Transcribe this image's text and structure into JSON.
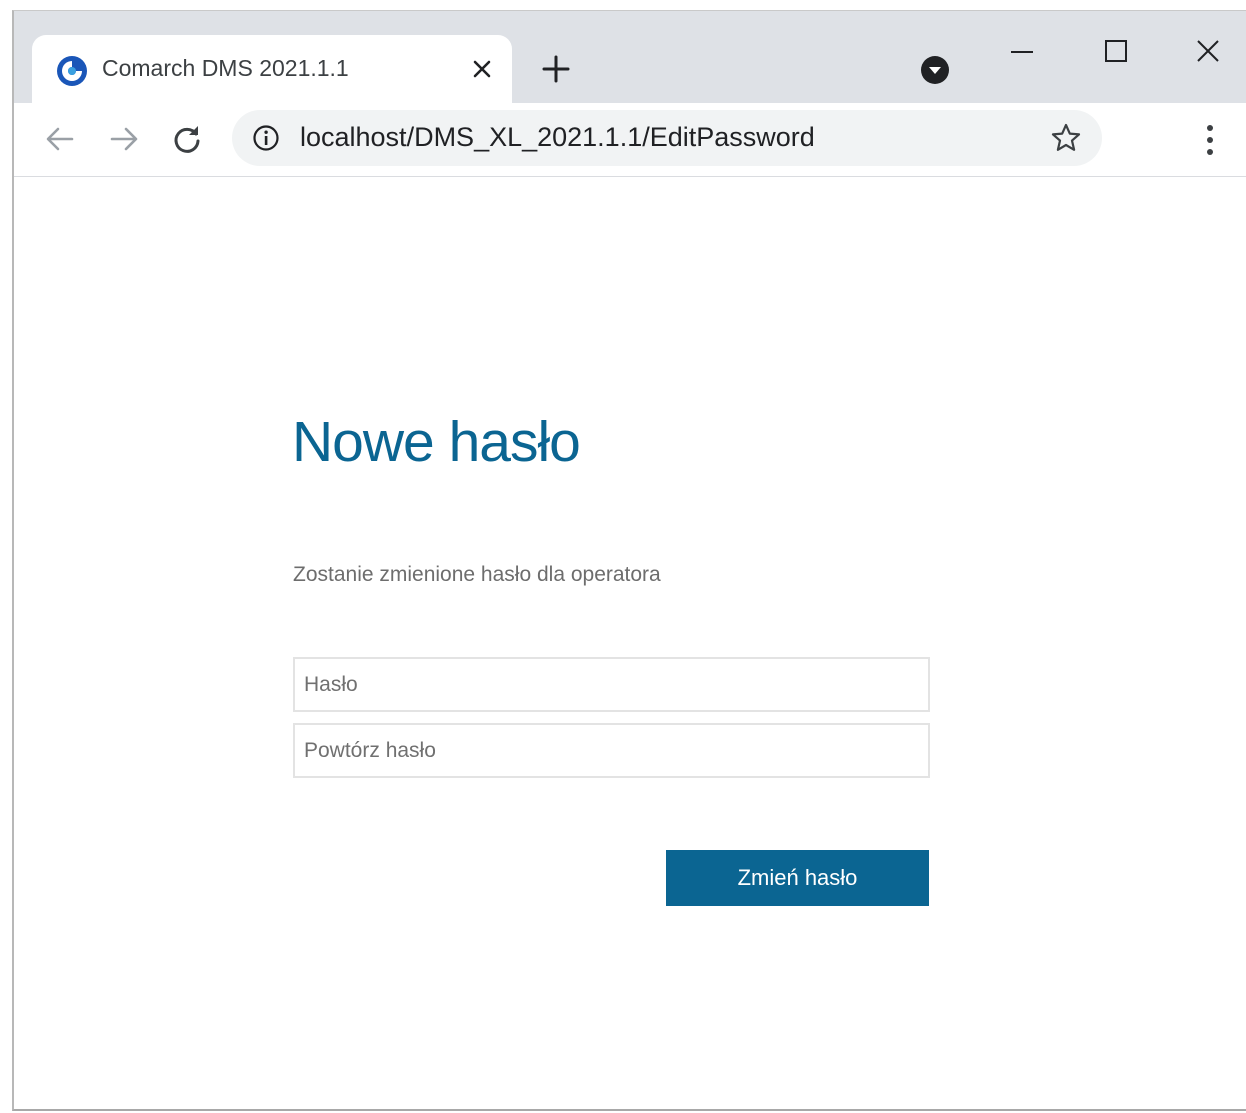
{
  "browser": {
    "tab": {
      "favicon": "comarch-logo-icon",
      "title": "Comarch DMS 2021.1.1",
      "close_icon": "close-icon"
    },
    "new_tab_icon": "plus-icon",
    "profile_icon": "profile-dropdown-icon",
    "window_controls": [
      "minimize-icon",
      "maximize-icon",
      "close-icon"
    ],
    "toolbar": {
      "back_icon": "arrow-left-icon",
      "forward_icon": "arrow-right-icon",
      "reload_icon": "reload-icon",
      "site_info_icon": "info-icon",
      "url": "localhost/DMS_XL_2021.1.1/EditPassword",
      "bookmark_icon": "star-icon",
      "menu_icon": "kebab-menu-icon"
    }
  },
  "page": {
    "title": "Nowe hasło",
    "subtitle": "Zostanie zmienione hasło dla operatora",
    "password_field": {
      "placeholder": "Hasło",
      "value": ""
    },
    "repeat_field": {
      "placeholder": "Powtórz hasło",
      "value": ""
    },
    "submit_label": "Zmień hasło"
  },
  "colors": {
    "accent": "#0b6592",
    "tabstrip": "#dee1e6",
    "omnibox": "#f1f3f4"
  }
}
